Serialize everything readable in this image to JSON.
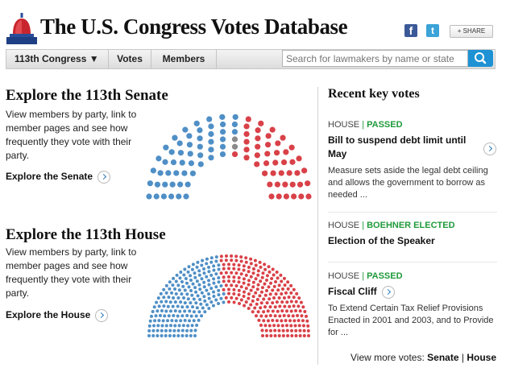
{
  "header": {
    "title": "The U.S. Congress Votes Database",
    "facebook_icon": "facebook-icon",
    "twitter_icon": "twitter-icon",
    "share_label": "SHARE"
  },
  "nav": {
    "congress_label": "113th Congress ▼",
    "votes_label": "Votes",
    "members_label": "Members",
    "search_placeholder": "Search for lawmakers by name or state"
  },
  "senate": {
    "heading": "Explore the 113th Senate",
    "description": "View members by party, link to member pages and see how frequently they vote with their party.",
    "link": "Explore the Senate",
    "seats": {
      "democrat": 53,
      "independent": 2,
      "republican": 45
    }
  },
  "house": {
    "heading": "Explore the 113th House",
    "description": "View members by party, link to member pages and see how frequently they vote with their party.",
    "link": "Explore the House",
    "seats": {
      "democrat": 200,
      "republican": 233
    }
  },
  "recent": {
    "heading": "Recent key votes",
    "votes": [
      {
        "chamber": "HOUSE",
        "result": "PASSED",
        "title": "Bill to suspend debt limit until May",
        "desc": "Measure sets aside the legal debt ceiling and allows the government to borrow as needed ..."
      },
      {
        "chamber": "HOUSE",
        "result": "BOEHNER ELECTED",
        "title": "Election of the Speaker",
        "desc": ""
      },
      {
        "chamber": "HOUSE",
        "result": "PASSED",
        "title": "Fiscal Cliff",
        "desc": "To Extend Certain Tax Relief Provisions Enacted in 2001 and 2003, and to Provide for ..."
      }
    ],
    "more_prefix": "View more votes:",
    "more_senate": "Senate",
    "more_sep": "|",
    "more_house": "House"
  },
  "colors": {
    "democrat": "#4f8fc6",
    "republican": "#d94148",
    "independent": "#8a8a8a",
    "accent": "#1e92d4",
    "passed": "#1f9a3a"
  }
}
